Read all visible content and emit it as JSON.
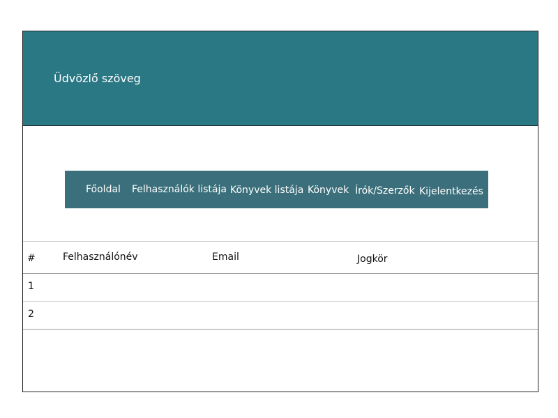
{
  "header": {
    "welcome_text": "Üdvözlő szöveg"
  },
  "nav": {
    "items": [
      {
        "label": "Főoldal"
      },
      {
        "label": "Felhasználók listája"
      },
      {
        "label": "Könyvek listája"
      },
      {
        "label": "Könyvek"
      },
      {
        "label": "Írók/Szerzők"
      },
      {
        "label": "Kijelentkezés"
      }
    ]
  },
  "table": {
    "headers": {
      "index": "#",
      "username": "Felhasználónév",
      "email": "Email",
      "role": "Jogkör"
    },
    "rows": [
      {
        "index": "1",
        "username": "",
        "email": "",
        "role": ""
      },
      {
        "index": "2",
        "username": "",
        "email": "",
        "role": ""
      }
    ]
  },
  "colors": {
    "header_bg": "#2b7885",
    "nav_bg": "#3a6f7b",
    "text_light": "#ffffff"
  }
}
